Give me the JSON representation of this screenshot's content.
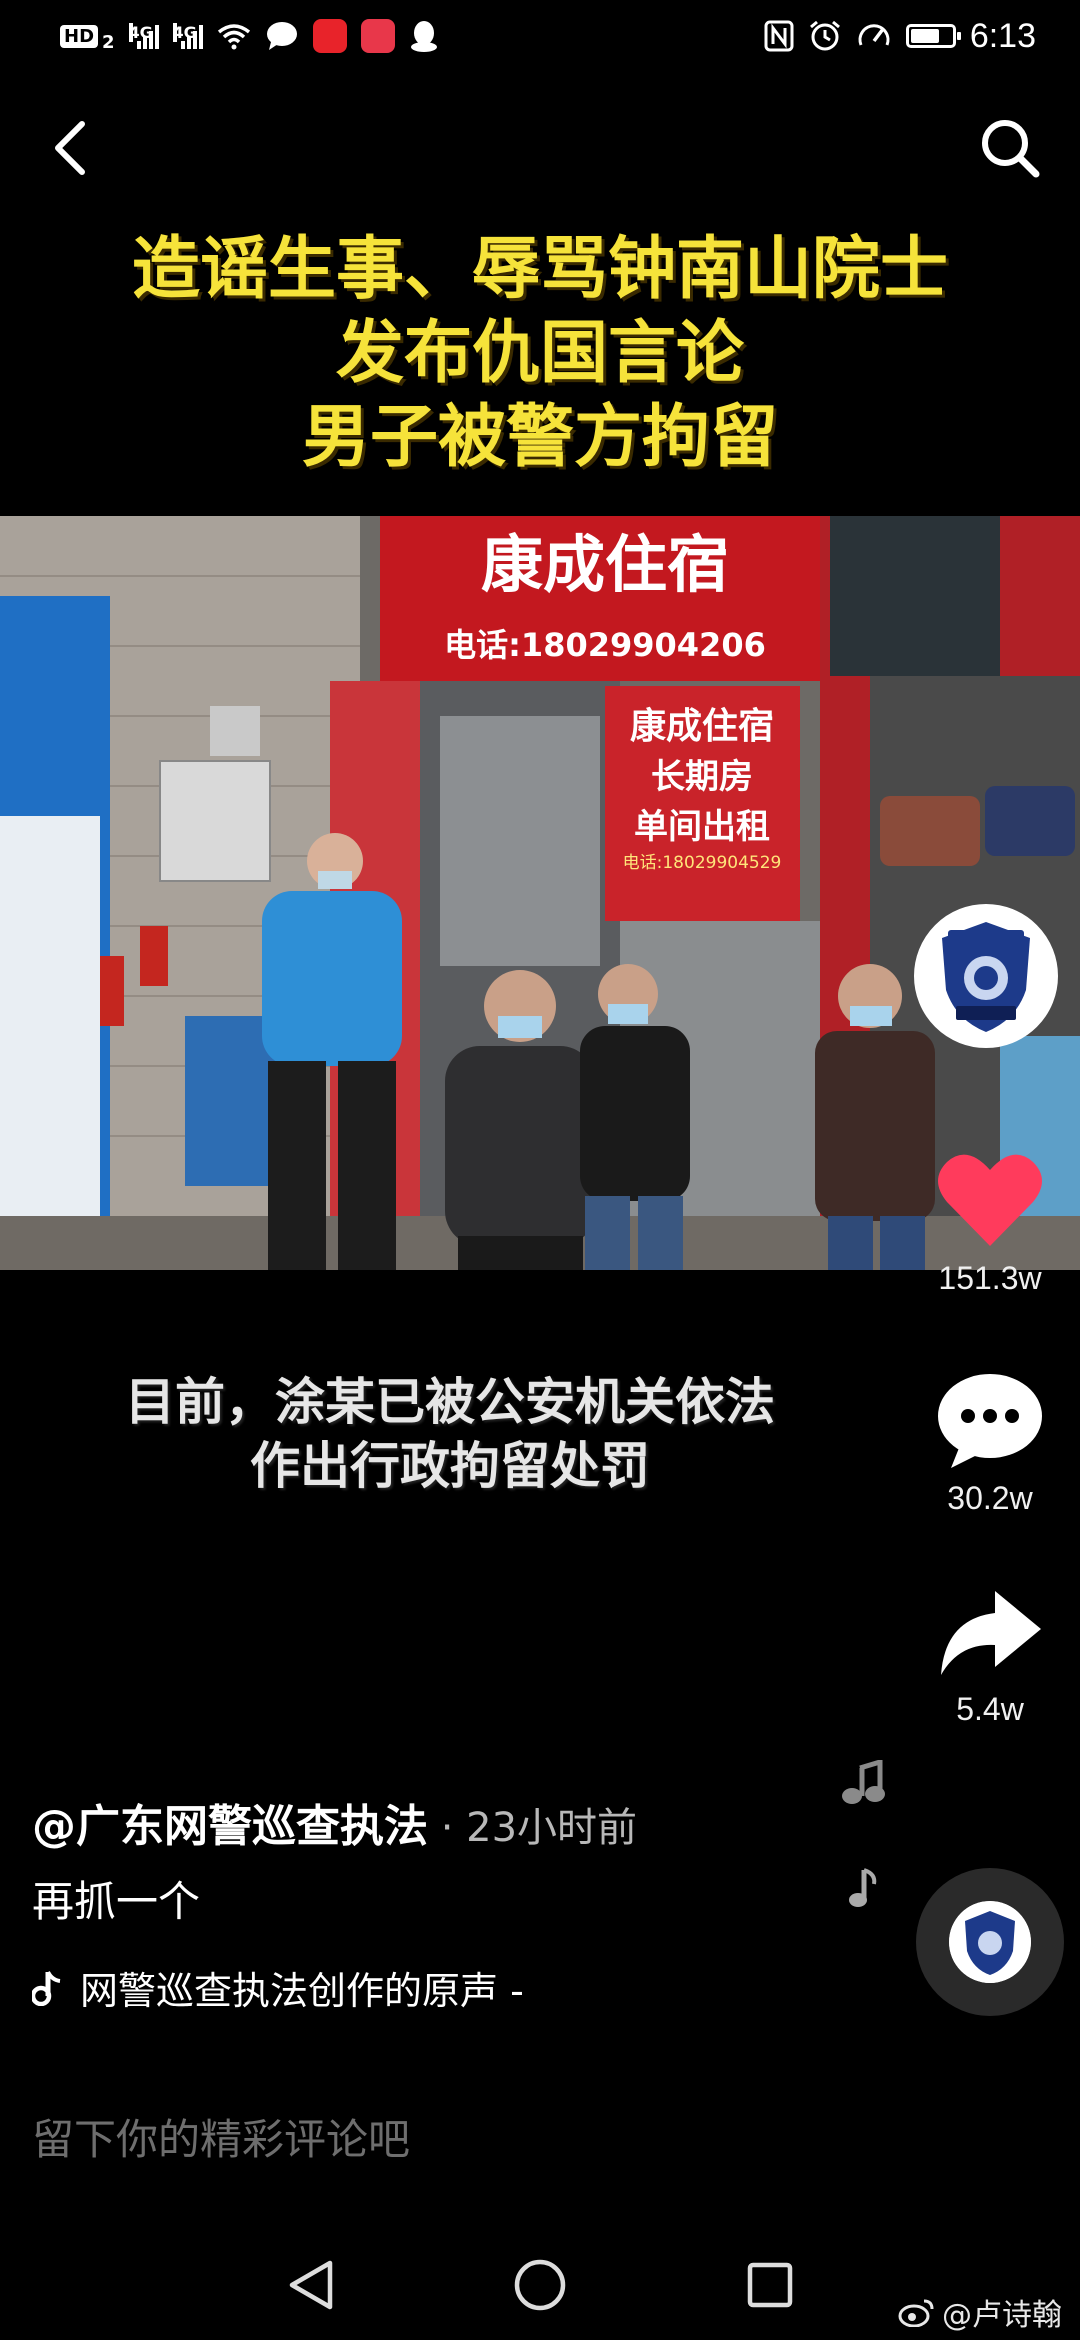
{
  "status_bar": {
    "hd": "HD",
    "sim_slot": "2",
    "net1": "4G",
    "net2": "4G",
    "time": "6:13",
    "battery_level": 0.7
  },
  "nav": {
    "back_icon": "chevron-left-icon",
    "search_icon": "search-icon"
  },
  "video": {
    "title_lines": [
      "造谣生事、辱骂钟南山院士",
      "发布仇国言论",
      "男子被警方拘留"
    ],
    "sign_main": "康成住宿",
    "sign_phone": "电话:18029904206",
    "sign_small_title": "康成住宿",
    "sign_small_line1": "长期房",
    "sign_small_line2": "单间出租",
    "sign_small_phone": "电话:18029904529",
    "subtitle_lines": [
      "目前，涂某已被公安机关依法",
      "作出行政拘留处罚"
    ]
  },
  "actions": {
    "like_count": "151.3w",
    "comment_count": "30.2w",
    "share_count": "5.4w",
    "like_color": "#ff3b5c"
  },
  "post": {
    "author": "@广东网警巡查执法",
    "time": " · 23小时前",
    "caption": "再抓一个",
    "music": "网警巡查执法创作的原声 -"
  },
  "comment": {
    "placeholder": "留下你的精彩评论吧"
  },
  "watermark": {
    "text": "@卢诗翰"
  }
}
